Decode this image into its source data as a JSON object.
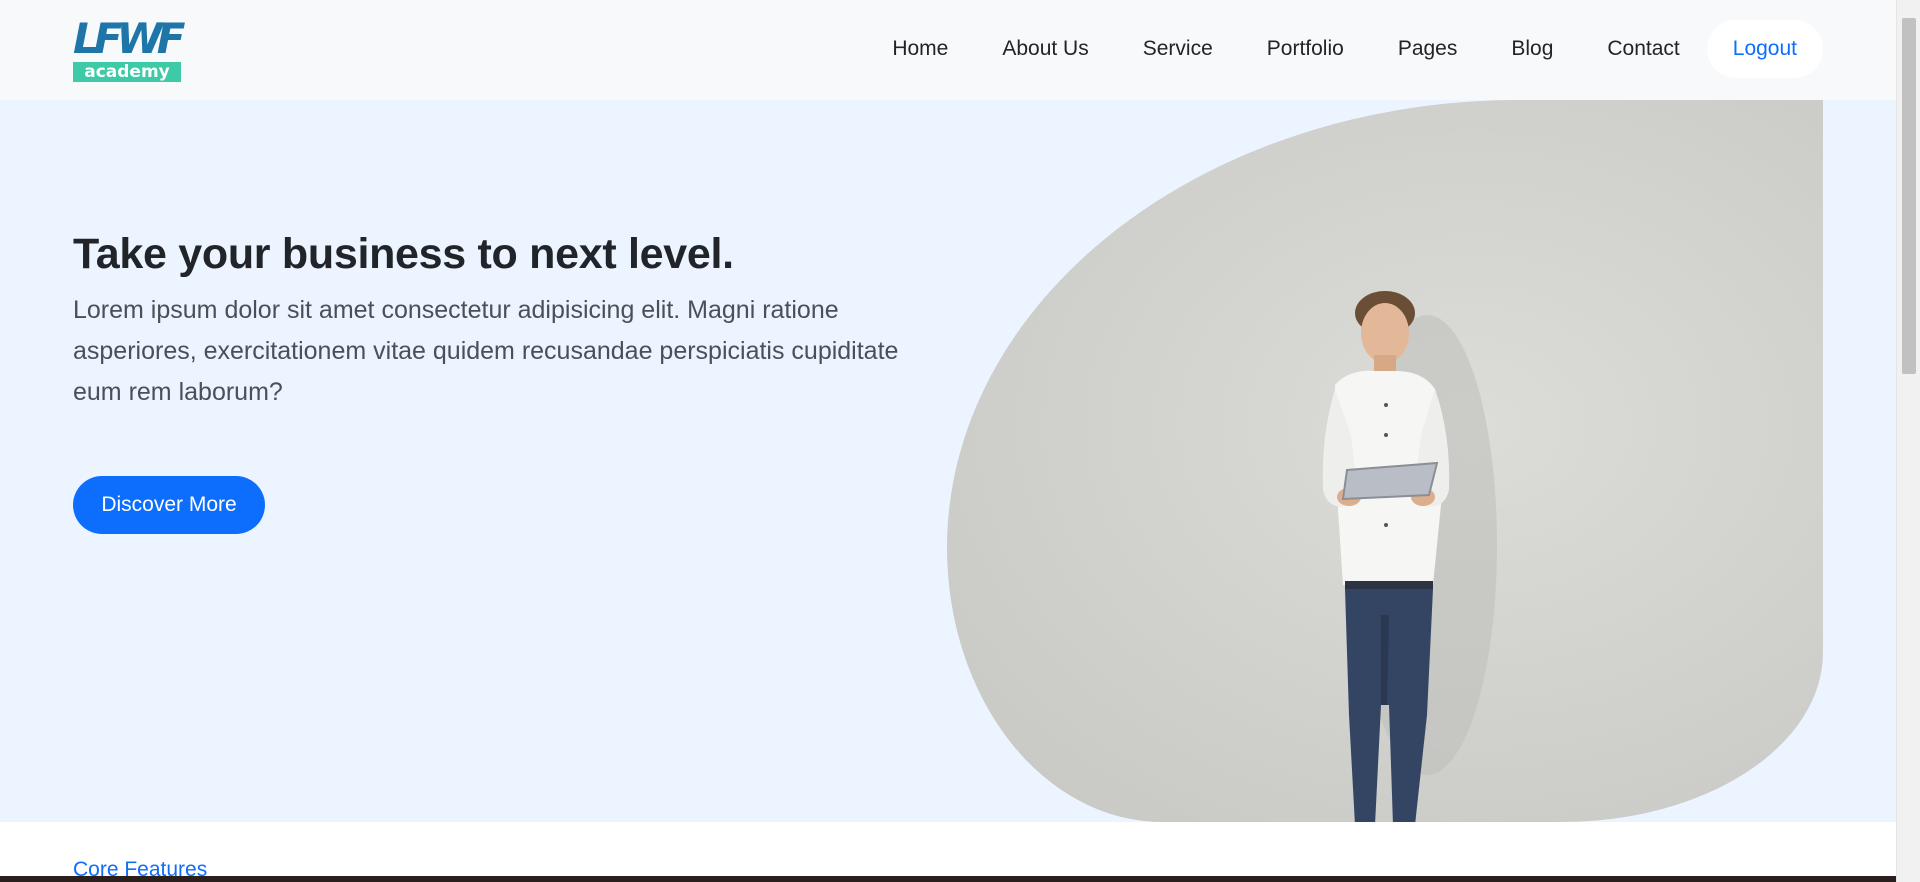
{
  "brand": {
    "logo_top": "LFWF",
    "logo_bottom": "academy"
  },
  "nav": {
    "items": [
      "Home",
      "About Us",
      "Service",
      "Portfolio",
      "Pages",
      "Blog",
      "Contact"
    ],
    "logout": "Logout"
  },
  "hero": {
    "title": "Take your business to next level.",
    "text": "Lorem ipsum dolor sit amet consectetur adipisicing elit. Magni ratione asperiores, exercitationem vitae quidem recusandae perspiciatis cupiditate eum rem laborum?",
    "button": "Discover More"
  },
  "section": {
    "label": "Core Features"
  },
  "colors": {
    "accent": "#0d6efd",
    "hero_bg": "#ebf4ff",
    "navbar_bg": "#f8f9fa",
    "logo_blue": "#1d75a8",
    "logo_green": "#3ec9a7"
  }
}
